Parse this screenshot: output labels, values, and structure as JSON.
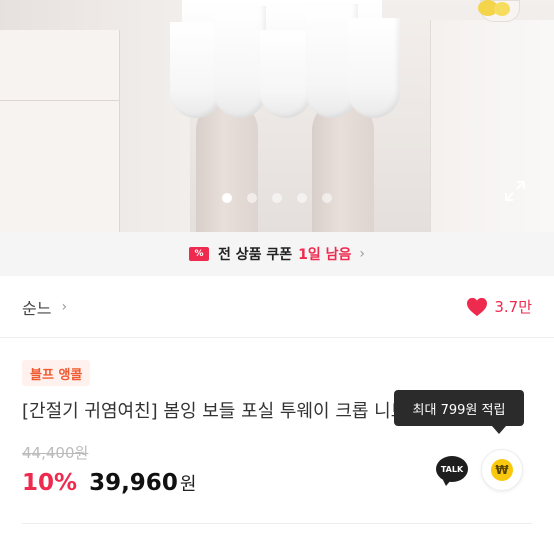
{
  "coupon_banner": {
    "icon": "coupon-ticket-icon",
    "icon_glyph": "%",
    "title": "전 상품 쿠폰",
    "remaining": "1일 남음",
    "chevron": "›"
  },
  "shop": {
    "name": "순느",
    "chevron": "›",
    "likes": "3.7만"
  },
  "gallery": {
    "image_count": 5,
    "current_index": 1
  },
  "product": {
    "badge": "블프 앵콜",
    "name": "[간절기 귀염여친] 봄잉 보들 포실 투웨이 크롭 니트 집업",
    "original_price": "44,400원",
    "discount": "10%",
    "price": "39,960",
    "currency": "원"
  },
  "reward": {
    "tooltip": "최대 799원 적립",
    "talk_label": "TALK",
    "coin_symbol": "₩"
  },
  "bottom": {
    "label": "",
    "amount": ""
  },
  "colors": {
    "accent": "#ee2a4e",
    "badge_text": "#f05a31",
    "badge_bg": "#fff2ee",
    "coin": "#f9c80e"
  }
}
